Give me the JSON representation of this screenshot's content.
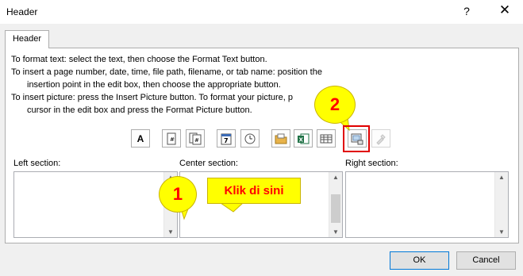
{
  "window": {
    "title": "Header",
    "help_label": "?",
    "close_label": "✕"
  },
  "tab": {
    "label": "Header"
  },
  "instructions": [
    "To format text:  select the text, then choose the Format Text button.",
    "To insert a page number, date, time, file path, filename, or tab name:  position the",
    "insertion point in the edit box, then choose the appropriate button.",
    "To insert picture: press the Insert Picture button.  To format your picture, p",
    "cursor in the edit box and press the Format Picture button."
  ],
  "toolbar": {
    "format_text_label": "A",
    "buttons": [
      {
        "name": "format-text",
        "icon": "letter-a-icon"
      },
      {
        "name": "insert-page-number",
        "icon": "page-number-icon"
      },
      {
        "name": "insert-number-of-pages",
        "icon": "number-of-pages-icon"
      },
      {
        "name": "insert-date",
        "icon": "calendar-icon"
      },
      {
        "name": "insert-time",
        "icon": "clock-icon"
      },
      {
        "name": "insert-file-path",
        "icon": "folder-icon"
      },
      {
        "name": "insert-file-name",
        "icon": "excel-icon"
      },
      {
        "name": "insert-sheet-name",
        "icon": "sheet-tab-icon"
      },
      {
        "name": "insert-picture",
        "icon": "picture-icon"
      },
      {
        "name": "format-picture",
        "icon": "format-picture-icon"
      }
    ]
  },
  "sections": {
    "left": "Left section:",
    "center": "Center section:",
    "right": "Right section:"
  },
  "buttons": {
    "ok": "OK",
    "cancel": "Cancel"
  },
  "annotations": {
    "callout_1": "1",
    "callout_2": "2",
    "klik": "Klik di sini"
  },
  "colors": {
    "accent": "#0078d7",
    "callout_fill": "#ffff00",
    "callout_text": "#ff0000",
    "highlight_border": "#e00000"
  }
}
